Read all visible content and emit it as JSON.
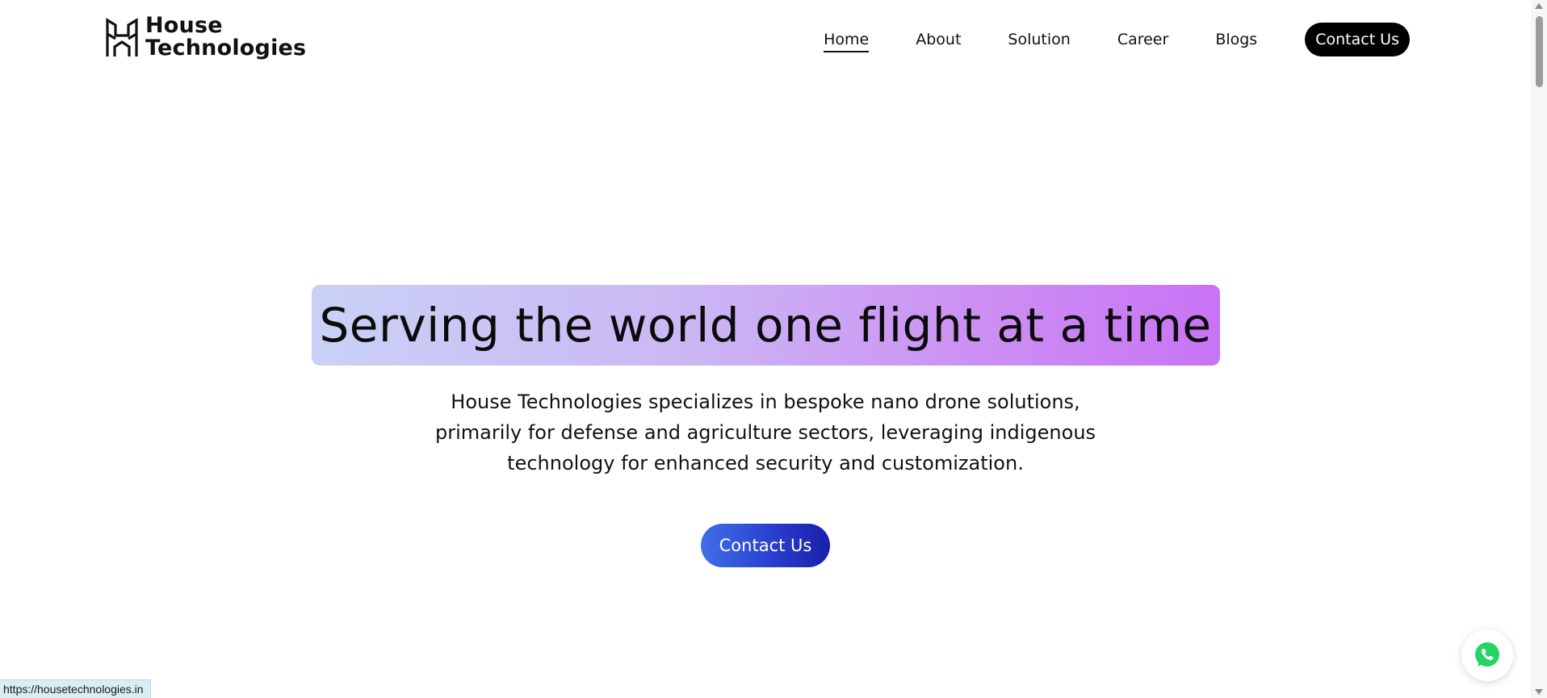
{
  "header": {
    "logo": {
      "line1": "House",
      "line2": "Technologies"
    },
    "nav": {
      "items": [
        {
          "label": "Home",
          "active": true
        },
        {
          "label": "About",
          "active": false
        },
        {
          "label": "Solution",
          "active": false
        },
        {
          "label": "Career",
          "active": false
        },
        {
          "label": "Blogs",
          "active": false
        }
      ],
      "cta_label": "Contact Us"
    }
  },
  "hero": {
    "title": "Serving the world one flight at a time",
    "description": "House Technologies specializes in bespoke nano drone solutions, primarily for defense and agriculture sectors, leveraging indigenous technology for enhanced security and customization.",
    "cta_label": "Contact Us"
  },
  "floating": {
    "icon": "whatsapp-icon",
    "color": "#25D366"
  },
  "status_bar": {
    "url": "https://housetechnologies.in"
  },
  "colors": {
    "nav_cta_bg": "#000000",
    "hero_gradient_start": "#c9d1f6",
    "hero_gradient_end": "#c873f5",
    "hero_cta_start": "#3f6fe8",
    "hero_cta_end": "#1a1fa8"
  }
}
